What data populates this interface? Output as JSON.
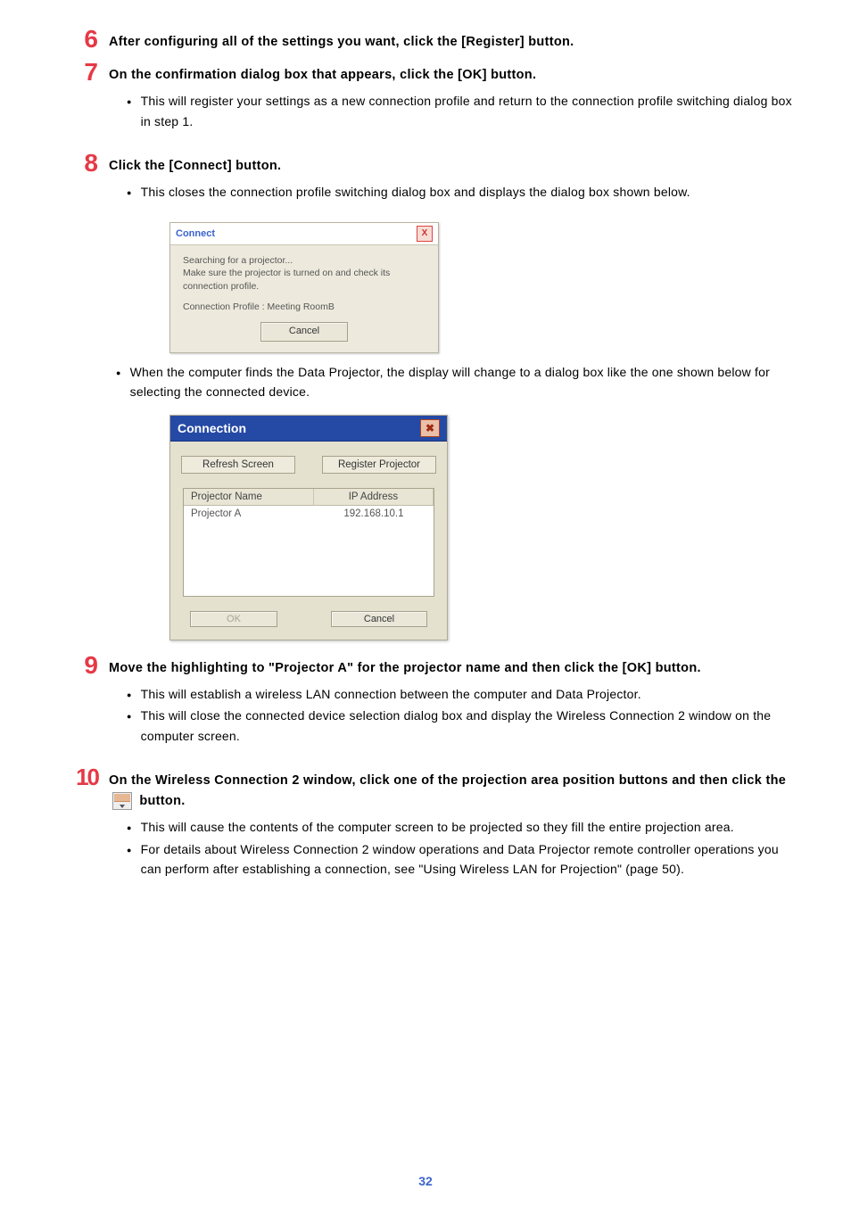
{
  "steps": {
    "s6": {
      "num": "6",
      "title": "After configuring all of the settings you want, click the [Register] button."
    },
    "s7": {
      "num": "7",
      "title": "On the confirmation dialog box that appears, click the [OK] button.",
      "bullet1": "This will register your settings as a new connection profile and return to the connection profile switching dialog box in step 1."
    },
    "s8": {
      "num": "8",
      "title": "Click the [Connect] button.",
      "bullet1": "This closes the connection profile switching dialog box and displays the dialog box shown below.",
      "bullet2": "When the computer finds the Data Projector, the display will change to a dialog box like the one shown below for selecting the connected device."
    },
    "s9": {
      "num": "9",
      "title": "Move the highlighting to \"Projector A\" for the projector name and then click the [OK] button.",
      "bullet1": "This will establish a wireless LAN connection between the computer and Data Projector.",
      "bullet2": "This will close the connected device selection dialog box and display the Wireless Connection 2 window on the computer screen."
    },
    "s10": {
      "num": "10",
      "title_a": "On the Wireless Connection 2 window, click one of the projection area position buttons and then click the ",
      "title_b": " button.",
      "bullet1": "This will cause the contents of the computer screen to be projected so they fill the entire projection area.",
      "bullet2": "For details about Wireless Connection 2 window operations and Data Projector remote controller operations you can perform after establishing a connection, see \"Using Wireless LAN for Projection\" (page 50)."
    }
  },
  "connect_dialog": {
    "title": "Connect",
    "line1": "Searching for a projector...",
    "line2": "Make sure the projector is turned on and check its connection profile.",
    "profile": "Connection Profile : Meeting RoomB",
    "cancel": "Cancel"
  },
  "connection_dialog": {
    "title": "Connection",
    "refresh": "Refresh Screen",
    "register": "Register Projector",
    "col_name": "Projector Name",
    "col_ip": "IP Address",
    "row_name": "Projector A",
    "row_ip": "192.168.10.1",
    "ok": "OK",
    "cancel": "Cancel"
  },
  "page_number": "32"
}
